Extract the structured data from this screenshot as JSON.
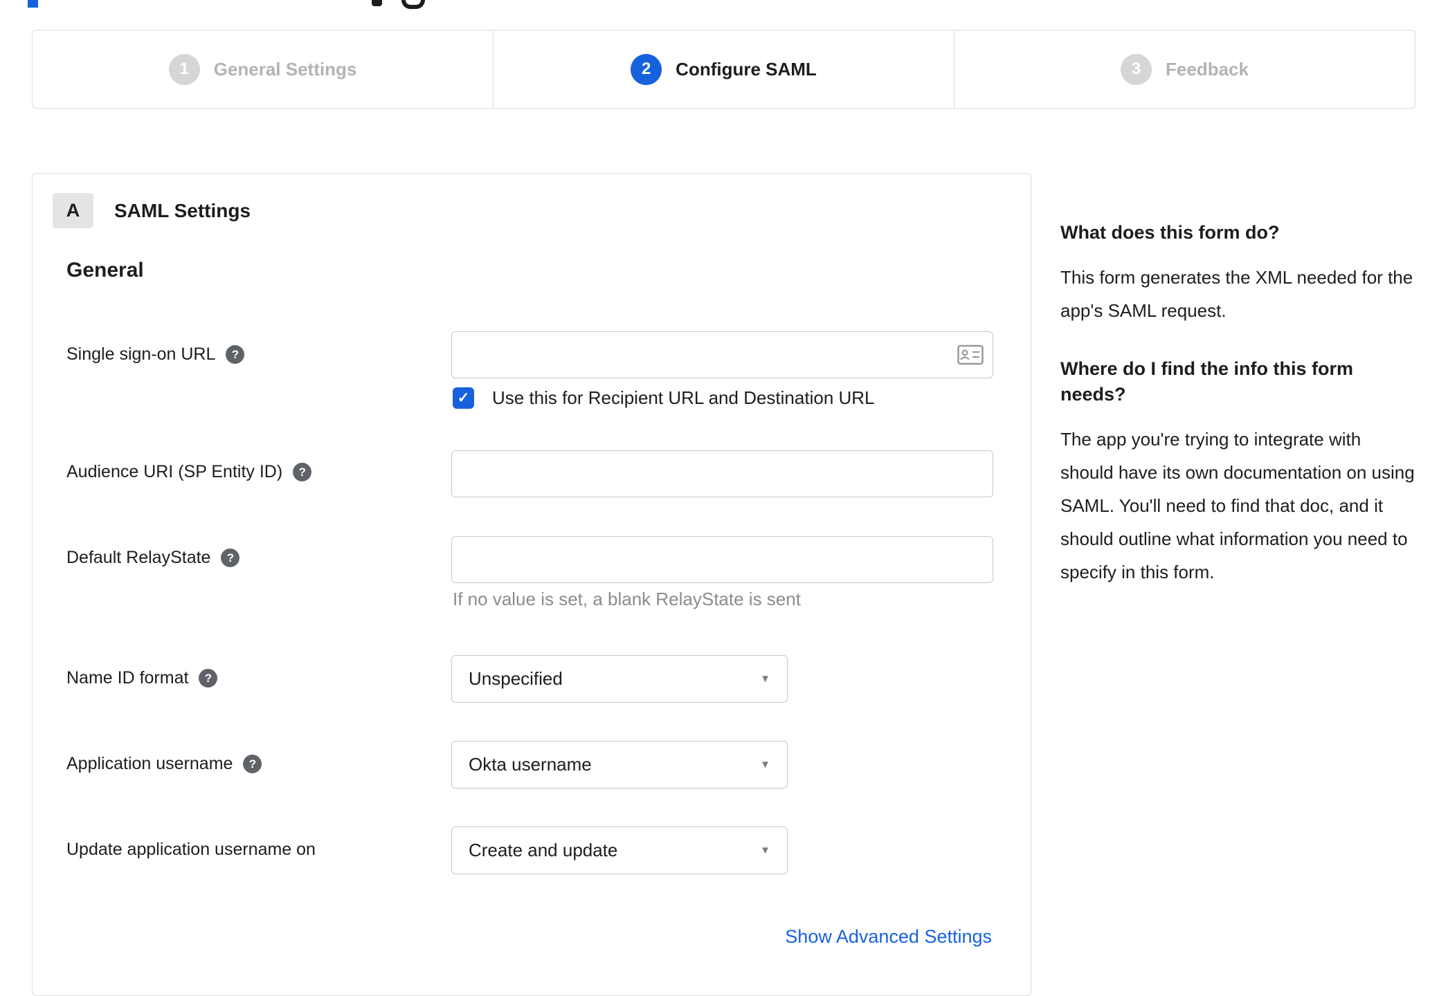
{
  "stepper": {
    "steps": [
      {
        "number": "1",
        "label": "General Settings",
        "state": "inactive"
      },
      {
        "number": "2",
        "label": "Configure SAML",
        "state": "active"
      },
      {
        "number": "3",
        "label": "Feedback",
        "state": "inactive"
      }
    ]
  },
  "panel": {
    "section_badge": "A",
    "section_title": "SAML Settings",
    "group_title": "General",
    "fields": {
      "sso_url": {
        "label": "Single sign-on URL",
        "value": ""
      },
      "sso_checkbox": {
        "label": "Use this for Recipient URL and Destination URL",
        "checked": true
      },
      "audience_uri": {
        "label": "Audience URI (SP Entity ID)",
        "value": ""
      },
      "default_relaystate": {
        "label": "Default RelayState",
        "value": "",
        "help_text": "If no value is set, a blank RelayState is sent"
      },
      "name_id_format": {
        "label": "Name ID format",
        "value": "Unspecified"
      },
      "application_username": {
        "label": "Application username",
        "value": "Okta username"
      },
      "update_application_username": {
        "label": "Update application username on",
        "value": "Create and update"
      }
    },
    "advanced_link": "Show Advanced Settings"
  },
  "sidebar": {
    "sections": [
      {
        "heading": "What does this form do?",
        "body": "This form generates the XML needed for the app's SAML request."
      },
      {
        "heading": "Where do I find the info this form needs?",
        "body": "The app you're trying to integrate with should have its own documentation on using SAML. You'll need to find that doc, and it should outline what information you need to specify in this form."
      }
    ]
  },
  "icons": {
    "help": "?",
    "check": "✓",
    "dropdown_caret": "▼"
  },
  "colors": {
    "accent_blue": "#1662dd",
    "inactive_gray": "#d6d6d6",
    "text": "#1d1d21",
    "border": "#dddddd",
    "helper_gray": "#8c8c8c"
  }
}
